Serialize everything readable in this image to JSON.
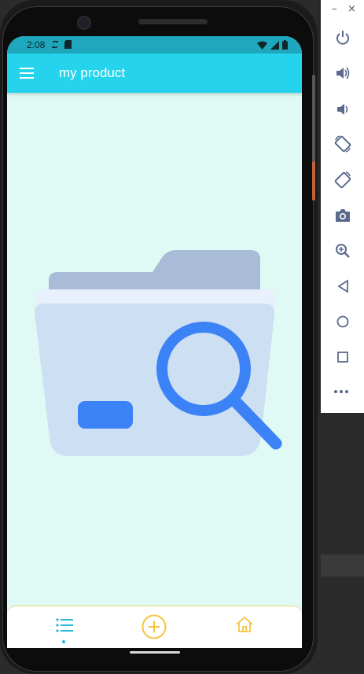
{
  "status_bar": {
    "time": "2:08",
    "left_icons": [
      "sync-icon",
      "sd-card-icon"
    ],
    "right_icons": [
      "wifi-icon",
      "signal-icon",
      "battery-icon"
    ]
  },
  "app_bar": {
    "title": "my product",
    "menu_icon": "menu-icon",
    "color": "#25d4ec"
  },
  "empty_state": {
    "illustration": "folder-search-icon",
    "colors": {
      "folder_back": "#a8bcd8",
      "folder_front": "#cddff2",
      "accent": "#3b82f6"
    }
  },
  "bottom_nav": {
    "items": [
      {
        "icon": "list-icon",
        "active": true
      },
      {
        "icon": "add-circle-icon",
        "active": false
      },
      {
        "icon": "home-icon",
        "active": false
      }
    ],
    "active_color": "#25b8d6",
    "inactive_color": "#f5c542"
  },
  "emulator_panel": {
    "window_controls": {
      "minimize": "–",
      "close": "×"
    },
    "tools": [
      "power-icon",
      "volume-up-icon",
      "volume-down-icon",
      "rotate-left-icon",
      "rotate-right-icon",
      "camera-icon",
      "zoom-icon",
      "back-icon",
      "home-icon",
      "overview-icon",
      "more-icon"
    ]
  }
}
